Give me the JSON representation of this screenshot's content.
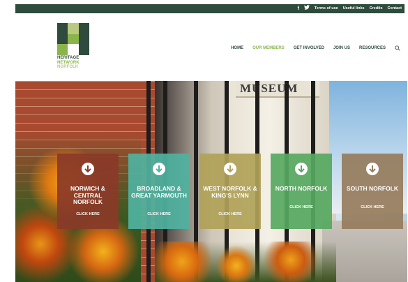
{
  "topbar": {
    "social": [
      {
        "icon": "facebook-icon",
        "glyph": "f"
      },
      {
        "icon": "twitter-icon",
        "glyph": "🐦"
      }
    ],
    "links": [
      "Terms of use",
      "Useful links",
      "Credits",
      "Contact"
    ]
  },
  "logo": {
    "lines": [
      "HERITAGE",
      "NETWORK",
      "NORFOLK"
    ],
    "colors": {
      "dark": "#2e4b3e",
      "green": "#8bb54a",
      "light": "#b9c982"
    }
  },
  "nav": {
    "items": [
      "HOME",
      "OUR MEMBERS",
      "GET INVOLVED",
      "JOIN US",
      "RESOURCES"
    ],
    "active_index": 1
  },
  "hero": {
    "sign_text": "MUSEUM"
  },
  "cards": [
    {
      "title": "NORWICH & CENTRAL NORFOLK",
      "cta": "CLICK HERE",
      "color": "#8a3a28"
    },
    {
      "title": "BROADLAND & GREAT YARMOUTH",
      "cta": "CLICK HERE",
      "color": "#4fb2a0"
    },
    {
      "title": "WEST NORFOLK & KING'S LYNN",
      "cta": "CLICK HERE",
      "color": "#b0a258"
    },
    {
      "title": "NORTH NORFOLK",
      "cta": "CLICK HERE",
      "color": "#56a860"
    },
    {
      "title": "SOUTH NORFOLK",
      "cta": "CLICK HERE",
      "color": "#967c5c"
    }
  ]
}
